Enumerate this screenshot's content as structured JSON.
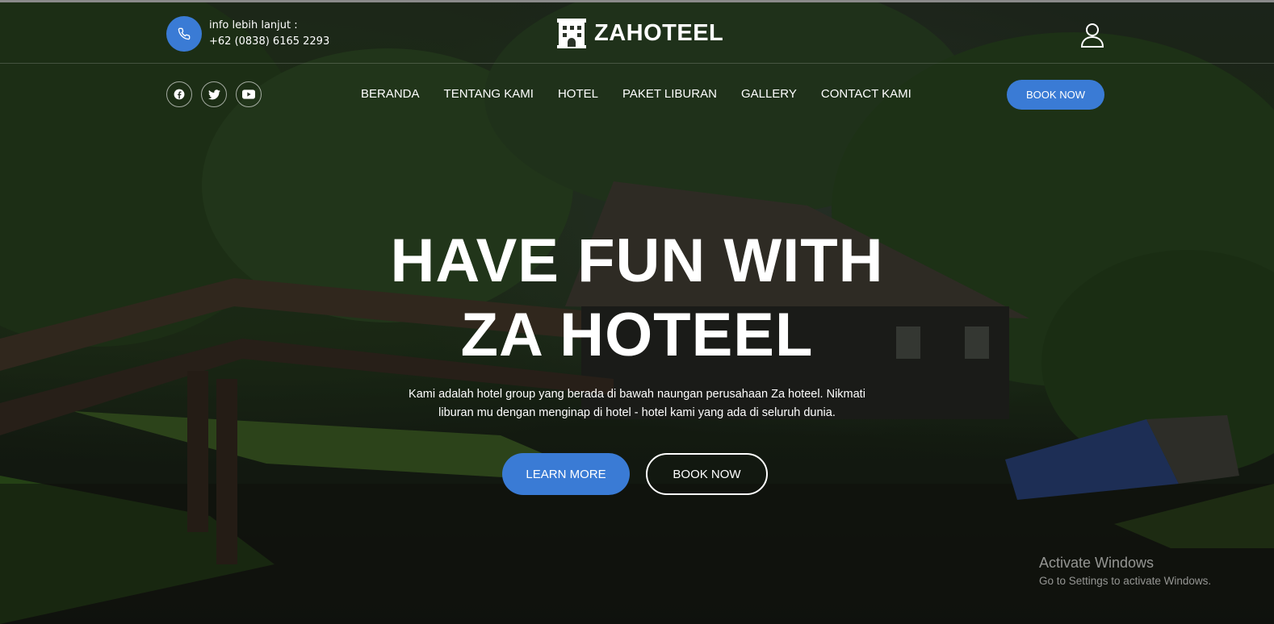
{
  "header": {
    "contact_label": "info lebih lanjut :",
    "contact_phone": "+62 (0838) 6165 2293",
    "logo_text": "ZAHOTEEL"
  },
  "nav": {
    "items": [
      "BERANDA",
      "TENTANG KAMI",
      "HOTEL",
      "PAKET LIBURAN",
      "GALLERY",
      "CONTACT KAMI"
    ],
    "book_label": "BOOK NOW"
  },
  "social": [
    "facebook-icon",
    "twitter-icon",
    "youtube-icon"
  ],
  "hero": {
    "title_line1": "HAVE FUN WITH",
    "title_line2": "ZA HOTEEL",
    "desc_line1": "Kami adalah hotel group yang berada di bawah naungan perusahaan Za hoteel. Nikmati",
    "desc_line2": "liburan mu dengan menginap di hotel - hotel kami yang ada di seluruh dunia.",
    "learn_label": "LEARN MORE",
    "book_label": "BOOK NOW"
  },
  "watermark": {
    "title": "Activate Windows",
    "subtitle": "Go to Settings to activate Windows."
  },
  "colors": {
    "accent": "#3a7bd5"
  }
}
